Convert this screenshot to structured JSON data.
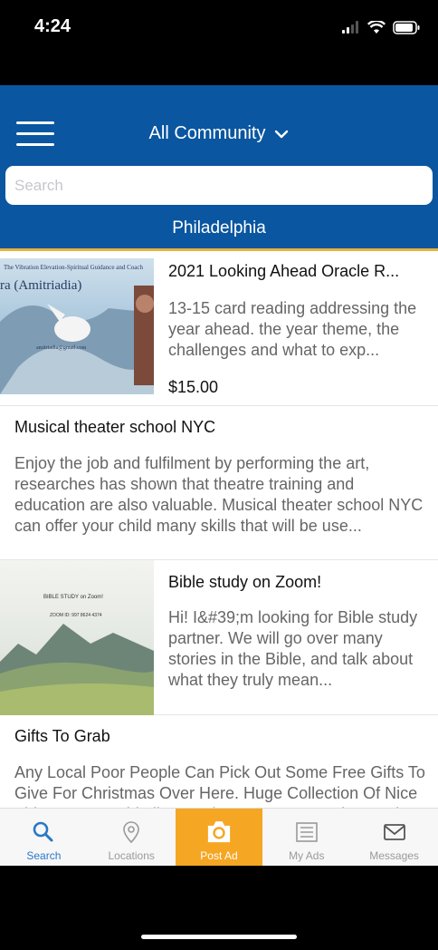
{
  "status": {
    "time": "4:24"
  },
  "header": {
    "community": "All Community",
    "search_placeholder": "Search",
    "city": "Philadelphia"
  },
  "listings": [
    {
      "title": "2021 Looking Ahead Oracle R...",
      "description": "13-15 card reading addressing the year ahead. the year theme, the challenges and what to exp...",
      "price": "$15.00",
      "image_text": {
        "line1": "The Vibration Elevation-Spiritual Guidance and Coach",
        "line2": "ra (Amitriadia)",
        "line3": "amitriadia@gmail.com"
      }
    },
    {
      "title": "Musical theater school NYC",
      "description": "Enjoy the job and fulfilment by performing the art, researches has shown that theatre training and education are also valuable. Musical theater school NYC can offer your child many skills that will be use..."
    },
    {
      "title": "Bible study on Zoom!",
      "description": "Hi! I&#39;m looking for Bible study partner. We will go over many stories in the Bible, and talk about what they truly mean...",
      "image_text": {
        "line1": "BIBLE STUDY on Zoom!",
        "line2": "ZOOM ID: 997 8624 4374"
      }
    },
    {
      "title": "Gifts To Grab",
      "description": "Any Local Poor People Can Pick Out Some Free Gifts To Give For Christmas Over Here. Huge Collection Of Nice Things We would Like To Give To Some Needy People"
    }
  ],
  "tabs": [
    {
      "label": "Search",
      "icon": "search-icon"
    },
    {
      "label": "Locations",
      "icon": "location-pin-icon"
    },
    {
      "label": "Post Ad",
      "icon": "camera-icon"
    },
    {
      "label": "My Ads",
      "icon": "list-icon"
    },
    {
      "label": "Messages",
      "icon": "envelope-icon"
    }
  ],
  "colors": {
    "header_blue": "#0a56a0",
    "accent_gold": "#e7b33c",
    "post_orange": "#f5a623",
    "active_blue": "#2a78c6"
  }
}
